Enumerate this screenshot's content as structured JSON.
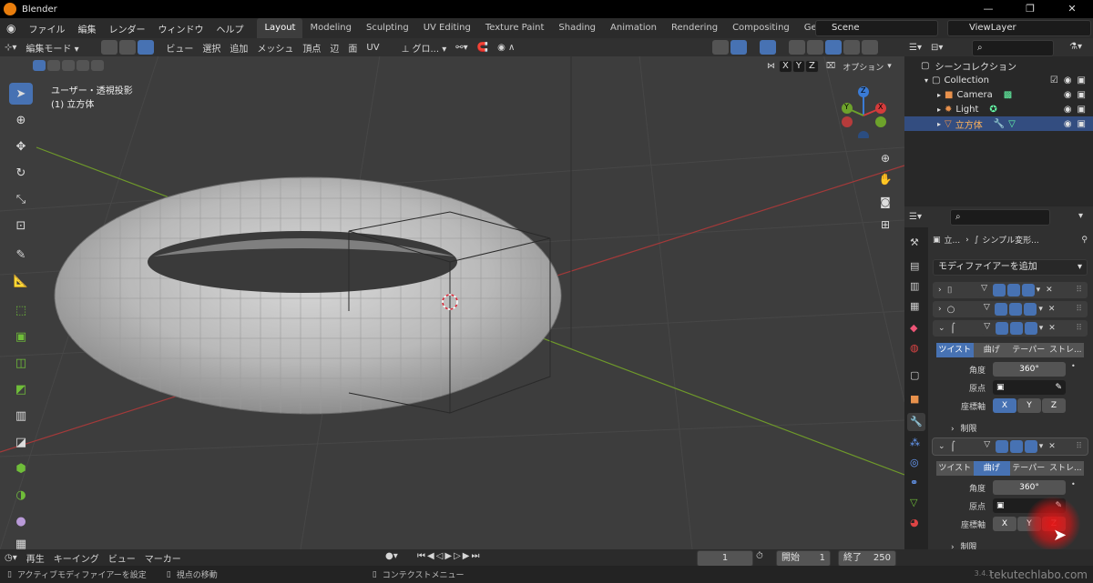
{
  "app": {
    "title": "Blender"
  },
  "window_buttons": [
    "—",
    "❐",
    "✕"
  ],
  "menus": [
    "ファイル",
    "編集",
    "レンダー",
    "ウィンドウ",
    "ヘルプ"
  ],
  "workspaces": [
    "Layout",
    "Modeling",
    "Sculpting",
    "UV Editing",
    "Texture Paint",
    "Shading",
    "Animation",
    "Rendering",
    "Compositing",
    "Geometry Node"
  ],
  "scene": {
    "name": "Scene",
    "view_layer": "ViewLayer"
  },
  "viewport_header": {
    "mode": "編集モード",
    "menus": [
      "ビュー",
      "選択",
      "追加",
      "メッシュ",
      "頂点",
      "辺",
      "面",
      "UV"
    ],
    "transform": "グロ...",
    "axes": [
      "X",
      "Y",
      "Z"
    ],
    "options": "オプション"
  },
  "viewport": {
    "view_name": "ユーザー・透視投影",
    "object_name": "(1) 立方体"
  },
  "gizmo": {
    "z": "Z",
    "y": "Y",
    "x": "X"
  },
  "outliner": {
    "root": "シーンコレクション",
    "collection": "Collection",
    "items": [
      "Camera",
      "Light",
      "立方体"
    ]
  },
  "properties": {
    "breadcrumb": [
      "立...",
      "シンプル変形..."
    ],
    "add_modifier": "モディファイアーを追加",
    "modifier_a": {
      "tabs": [
        "ツイスト",
        "曲げ",
        "テーパー",
        "ストレ..."
      ],
      "active_tab": 0,
      "angle_label": "角度",
      "angle": "360°",
      "origin_label": "原点",
      "axis_label": "座標軸",
      "axes": [
        "X",
        "Y",
        "Z"
      ],
      "active_axis": 0,
      "limits": "制限"
    },
    "modifier_b": {
      "tabs": [
        "ツイスト",
        "曲げ",
        "テーパー",
        "ストレ..."
      ],
      "active_tab": 1,
      "angle_label": "角度",
      "angle": "360°",
      "origin_label": "原点",
      "axis_label": "座標軸",
      "axes": [
        "X",
        "Y",
        "Z"
      ],
      "limits": "制限"
    }
  },
  "timeline": {
    "menus": [
      "再生",
      "キーイング",
      "ビュー",
      "マーカー"
    ],
    "current_frame": "1",
    "start_label": "開始",
    "start": "1",
    "end_label": "終了",
    "end": "250"
  },
  "status": {
    "left": "アクティブモディファイアーを設定",
    "middle": "視点の移動",
    "right": "コンテクストメニュー",
    "version": "3.4.1",
    "watermark": "tekutechlabo.com"
  },
  "colors": {
    "accent": "#4772b3",
    "selected": "#334d80",
    "object_orange": "#e87d0d"
  }
}
